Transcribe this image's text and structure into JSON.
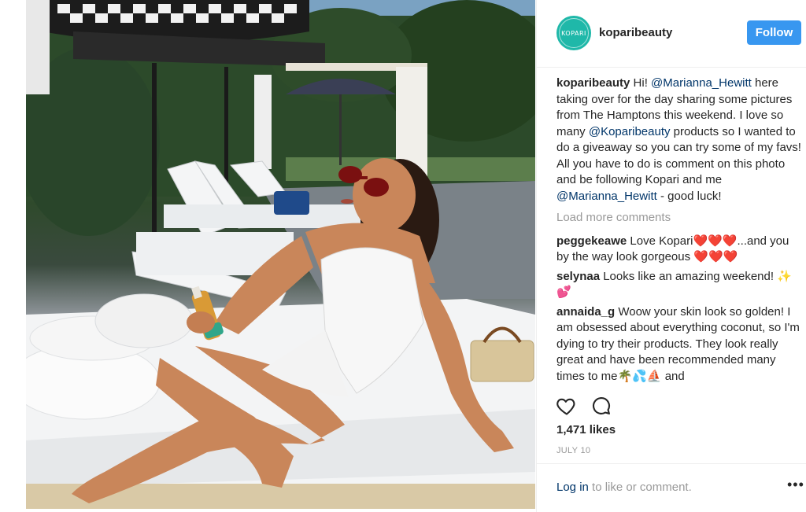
{
  "account": {
    "username": "koparibeauty",
    "avatar_text": "KOPARI",
    "follow_label": "Follow"
  },
  "caption": {
    "user": "koparibeauty",
    "part1": " Hi! ",
    "mention1": "@Marianna_Hewitt",
    "part2": " here taking over for the day sharing some pictures from The Hamptons this weekend. I love so many ",
    "mention2": "@Koparibeauty",
    "part3": " products so I wanted to do a giveaway so you can try some of my favs! All you have to do is comment on this photo and be following Kopari and me ",
    "mention3": "@Marianna_Hewitt",
    "part4": " - good luck!"
  },
  "load_more": "Load more comments",
  "comments": [
    {
      "user": "peggekeawe",
      "text_before": " Love Kopari",
      "hearts1": "❤️❤️❤️",
      "text_after": "...and you by the way look gorgeous ",
      "hearts2": "❤️❤️❤️"
    },
    {
      "user": "selynaa",
      "text": " Looks like an amazing weekend! ✨💕"
    },
    {
      "user": "annaida_g",
      "text": " Woow your skin look so golden! I am obsessed about everything coconut, so I'm dying to try their products. They look really great and have been recommended many times to me🌴💦⛵ and"
    }
  ],
  "actions": {
    "like_icon": "heart-outline-icon",
    "comment_icon": "comment-bubble-icon"
  },
  "likes": "1,471 likes",
  "date": "JULY 10",
  "footer": {
    "login_link": "Log in",
    "login_rest": " to like or comment.",
    "more": "•••"
  },
  "colors": {
    "follow_button": "#3897f0",
    "avatar": "#1fb8a9",
    "mention": "#003569",
    "muted": "#999999"
  }
}
